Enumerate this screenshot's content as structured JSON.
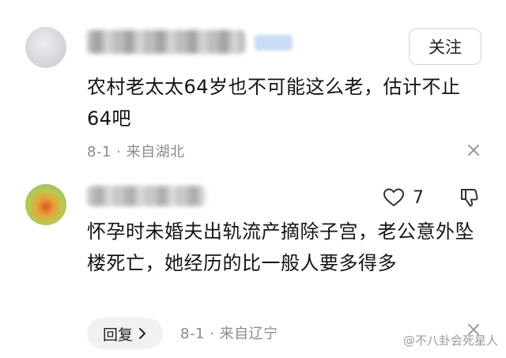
{
  "comment1": {
    "follow_label": "关注",
    "text": "农村老太太64岁也不可能这么老，估计不止64吧",
    "date": "8-1",
    "separator": "·",
    "location": "来自湖北"
  },
  "comment2": {
    "like_count": "7",
    "text": "怀孕时未婚夫出轨流产摘除子宫，老公意外坠楼死亡，她经历的比一般人要多得多",
    "reply_label": "回复",
    "date": "8-1",
    "separator": "·",
    "location": "来自辽宁"
  },
  "watermark": {
    "text": "@不八卦会死星人"
  },
  "icons": {
    "close": "close-icon",
    "like": "heart-icon",
    "dislike": "thumbs-down-icon",
    "chevron": "chevron-right-icon"
  }
}
